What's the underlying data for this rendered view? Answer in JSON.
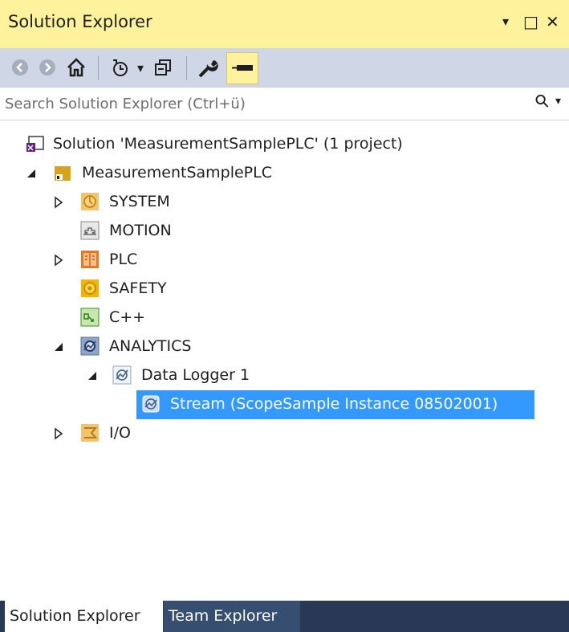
{
  "window": {
    "title": "Solution Explorer",
    "dropdown_glyph": "▾",
    "maximize_glyph": "□",
    "close_glyph": "✕"
  },
  "toolbar": {
    "icons": [
      "back-icon",
      "forward-icon",
      "home-icon",
      "pending-changes-icon",
      "collapse-all-icon",
      "properties-icon",
      "pin-icon"
    ],
    "dropdown_glyph": "▾"
  },
  "search": {
    "placeholder": "Search Solution Explorer (Ctrl+ü)",
    "icon_glyph": "⚲",
    "dropdown_glyph": "▾"
  },
  "tree": {
    "solution": "Solution 'MeasurementSamplePLC' (1 project)",
    "project": "MeasurementSamplePLC",
    "system": "SYSTEM",
    "motion": "MOTION",
    "plc": "PLC",
    "safety": "SAFETY",
    "cpp": "C++",
    "analytics": "ANALYTICS",
    "data_logger": "Data Logger 1",
    "stream": "Stream (ScopeSample Instance 08502001)",
    "io": "I/O"
  },
  "tabs": {
    "active": "Solution Explorer",
    "inactive": "Team Explorer"
  },
  "colors": {
    "title_bg": "#fff29d",
    "toolbar_bg": "#cfd6e5",
    "selection": "#3399ff",
    "tab_strip": "#293955"
  }
}
